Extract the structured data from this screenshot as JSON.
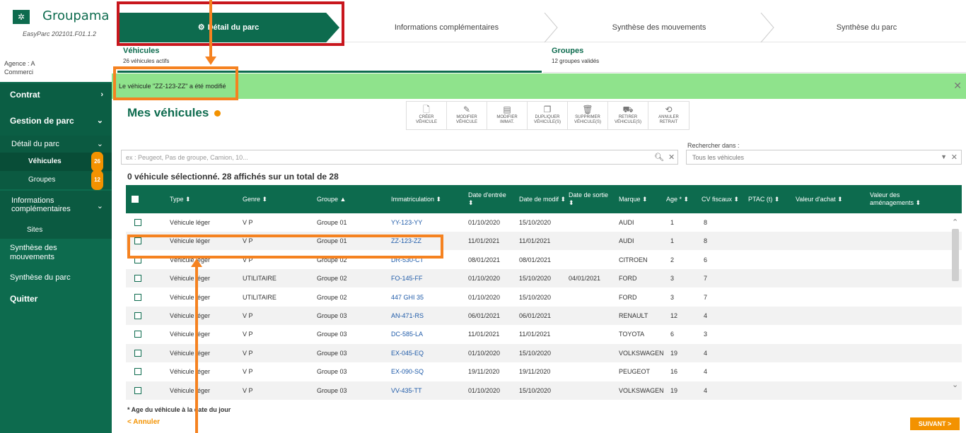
{
  "brand": {
    "name": "Groupama",
    "version": "EasyParc 202101.F01.1.2",
    "agency_line1": "Agence : A",
    "agency_line2": "Commerci"
  },
  "nav": {
    "contrat": "Contrat",
    "gestion": "Gestion de parc",
    "detail": "Détail du parc",
    "vehicules": "Véhicules",
    "vehicules_count": "26",
    "groupes": "Groupes",
    "groupes_count": "12",
    "infos": "Informations complémentaires",
    "sites": "Sites",
    "synth_mouv": "Synthèse des mouvements",
    "synth_parc": "Synthèse du parc",
    "quitter": "Quitter"
  },
  "stepper": [
    "Détail du parc",
    "Informations complémentaires",
    "Synthèse des mouvements",
    "Synthèse du parc"
  ],
  "summary": {
    "veh_title": "Véhicules",
    "veh_sub": "26 véhicules actifs",
    "grp_title": "Groupes",
    "grp_sub": "12 groupes validés"
  },
  "banner": {
    "text": "Le véhicule \"ZZ-123-ZZ\" a été modifié",
    "close": "✕"
  },
  "page_title": "Mes véhicules",
  "toolbar": [
    {
      "l1": "CRÉER",
      "l2": "VÉHICULE",
      "icon": "file-plus-icon",
      "glyph": "🗋"
    },
    {
      "l1": "MODIFIER",
      "l2": "VÉHICULE",
      "icon": "pencil-icon",
      "glyph": "✎"
    },
    {
      "l1": "MODIFIER",
      "l2": "IMMAT.",
      "icon": "edit-plate-icon",
      "glyph": "▤"
    },
    {
      "l1": "DUPLIQUER",
      "l2": "VÉHICULE(S)",
      "icon": "duplicate-icon",
      "glyph": "❐"
    },
    {
      "l1": "SUPPRIMER",
      "l2": "VÉHICULE(S)",
      "icon": "trash-icon",
      "glyph": "🗑"
    },
    {
      "l1": "RETIRER",
      "l2": "VÉHICULE(S)",
      "icon": "car-remove-icon",
      "glyph": "⛟"
    },
    {
      "l1": "ANNULER",
      "l2": "RETRAIT",
      "icon": "car-undo-icon",
      "glyph": "⟲"
    }
  ],
  "search": {
    "label": "Rechercher dans :",
    "placeholder": "ex : Peugeot, Pas de groupe, Camion, 10...",
    "scope": "Tous les véhicules"
  },
  "selection_text": "0 véhicule sélectionné. 28 affichés sur un total de 28",
  "columns": {
    "type": "Type ⬍",
    "genre": "Genre ⬍",
    "groupe": "Groupe ▲",
    "immat": "Immatriculation ⬍",
    "date_entree": "Date d'entrée ⬍",
    "date_modif": "Date de modif ⬍",
    "date_sortie": "Date de sortie ⬍",
    "marque": "Marque ⬍",
    "age": "Age * ⬍",
    "cv": "CV fiscaux ⬍",
    "ptac": "PTAC (t) ⬍",
    "achat": "Valeur d'achat ⬍",
    "amenag": "Valeur des aménagements ⬍"
  },
  "rows": [
    {
      "type": "Véhicule léger",
      "genre": "V P",
      "groupe": "Groupe 01",
      "immat": "YY-123-YY",
      "entree": "01/10/2020",
      "modif": "15/10/2020",
      "sortie": "",
      "marque": "AUDI",
      "age": "1",
      "cv": "8"
    },
    {
      "type": "Véhicule léger",
      "genre": "V P",
      "groupe": "Groupe 01",
      "immat": "ZZ-123-ZZ",
      "entree": "11/01/2021",
      "modif": "11/01/2021",
      "sortie": "",
      "marque": "AUDI",
      "age": "1",
      "cv": "8"
    },
    {
      "type": "Véhicule léger",
      "genre": "V P",
      "groupe": "Groupe 02",
      "immat": "DR-530-CT",
      "entree": "08/01/2021",
      "modif": "08/01/2021",
      "sortie": "",
      "marque": "CITROEN",
      "age": "2",
      "cv": "6"
    },
    {
      "type": "Véhicule léger",
      "genre": "UTILITAIRE",
      "groupe": "Groupe 02",
      "immat": "FO-145-FF",
      "entree": "01/10/2020",
      "modif": "15/10/2020",
      "sortie": "04/01/2021",
      "marque": "FORD",
      "age": "3",
      "cv": "7"
    },
    {
      "type": "Véhicule léger",
      "genre": "UTILITAIRE",
      "groupe": "Groupe 02",
      "immat": "447 GHI 35",
      "entree": "01/10/2020",
      "modif": "15/10/2020",
      "sortie": "",
      "marque": "FORD",
      "age": "3",
      "cv": "7"
    },
    {
      "type": "Véhicule léger",
      "genre": "V P",
      "groupe": "Groupe 03",
      "immat": "AN-471-RS",
      "entree": "06/01/2021",
      "modif": "06/01/2021",
      "sortie": "",
      "marque": "RENAULT",
      "age": "12",
      "cv": "4"
    },
    {
      "type": "Véhicule léger",
      "genre": "V P",
      "groupe": "Groupe 03",
      "immat": "DC-585-LA",
      "entree": "11/01/2021",
      "modif": "11/01/2021",
      "sortie": "",
      "marque": "TOYOTA",
      "age": "6",
      "cv": "3"
    },
    {
      "type": "Véhicule léger",
      "genre": "V P",
      "groupe": "Groupe 03",
      "immat": "EX-045-EQ",
      "entree": "01/10/2020",
      "modif": "15/10/2020",
      "sortie": "",
      "marque": "VOLKSWAGEN",
      "age": "19",
      "cv": "4"
    },
    {
      "type": "Véhicule léger",
      "genre": "V P",
      "groupe": "Groupe 03",
      "immat": "EX-090-SQ",
      "entree": "19/11/2020",
      "modif": "19/11/2020",
      "sortie": "",
      "marque": "PEUGEOT",
      "age": "16",
      "cv": "4"
    },
    {
      "type": "Véhicule léger",
      "genre": "V P",
      "groupe": "Groupe 03",
      "immat": "VV-435-TT",
      "entree": "01/10/2020",
      "modif": "15/10/2020",
      "sortie": "",
      "marque": "VOLKSWAGEN",
      "age": "19",
      "cv": "4"
    }
  ],
  "footnote": "* Age du véhicule à la date du jour",
  "cancel": "< Annuler",
  "next": "SUIVANT >",
  "colors": {
    "brand_green": "#0d6b4e",
    "accent_orange": "#f39200",
    "banner_green": "#8fe38c",
    "annotation_red": "#c8161d",
    "annotation_orange": "#f58220"
  }
}
